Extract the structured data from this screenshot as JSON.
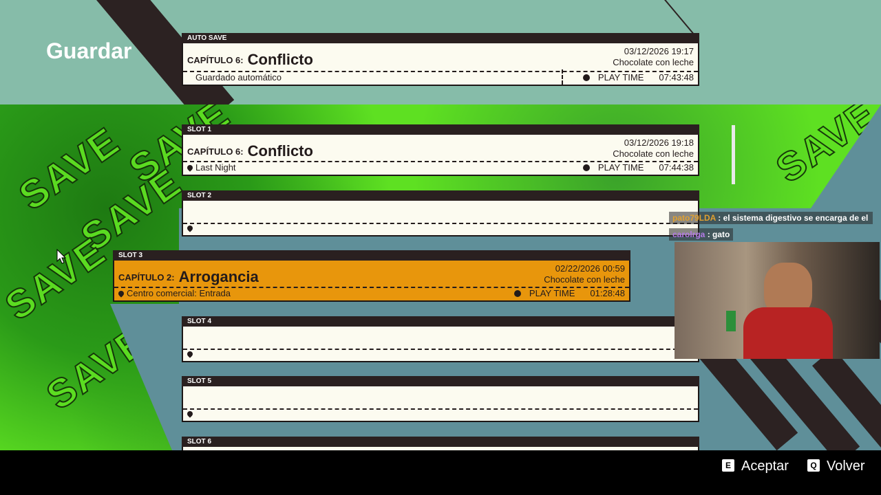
{
  "page_title": "Guardar",
  "auto_save": {
    "tab": "AUTO SAVE",
    "chapter_label": "CAPÍTULO 6:",
    "chapter_name": "Conflicto",
    "date": "03/12/2026 19:17",
    "profile": "Chocolate con leche",
    "location": "Guardado automático",
    "play_time_label": "PLAY TIME",
    "play_time": "07:43:48"
  },
  "slots": [
    {
      "tab": "SLOT 1",
      "chapter_label": "CAPÍTULO 6:",
      "chapter_name": "Conflicto",
      "date": "03/12/2026 19:18",
      "profile": "Chocolate con leche",
      "location": "Last Night",
      "play_time_label": "PLAY TIME",
      "play_time": "07:44:38"
    },
    {
      "tab": "SLOT 2"
    },
    {
      "tab": "SLOT 3",
      "chapter_label": "CAPÍTULO 2:",
      "chapter_name": "Arrogancia",
      "date": "02/22/2026 00:59",
      "profile": "Chocolate con leche",
      "location": "Centro comercial: Entrada",
      "play_time_label": "PLAY TIME",
      "play_time": "01:28:48"
    },
    {
      "tab": "SLOT 4"
    },
    {
      "tab": "SLOT 5"
    },
    {
      "tab": "SLOT 6"
    }
  ],
  "background_word": "SAVE",
  "chat": [
    {
      "user": "pato79LDA",
      "user_color": "#e0a030",
      "message": "el sistema digestivo se encarga de el"
    },
    {
      "user": "carolrga",
      "user_color": "#b57be8",
      "message": "gato"
    }
  ],
  "footer": {
    "accept_key": "E",
    "accept_label": "Aceptar",
    "back_key": "Q",
    "back_label": "Volver"
  },
  "colors": {
    "active_slot": "#e8960c",
    "card": "#fcfbf0",
    "top_band": "#86bca9",
    "green": "#5ee022"
  }
}
